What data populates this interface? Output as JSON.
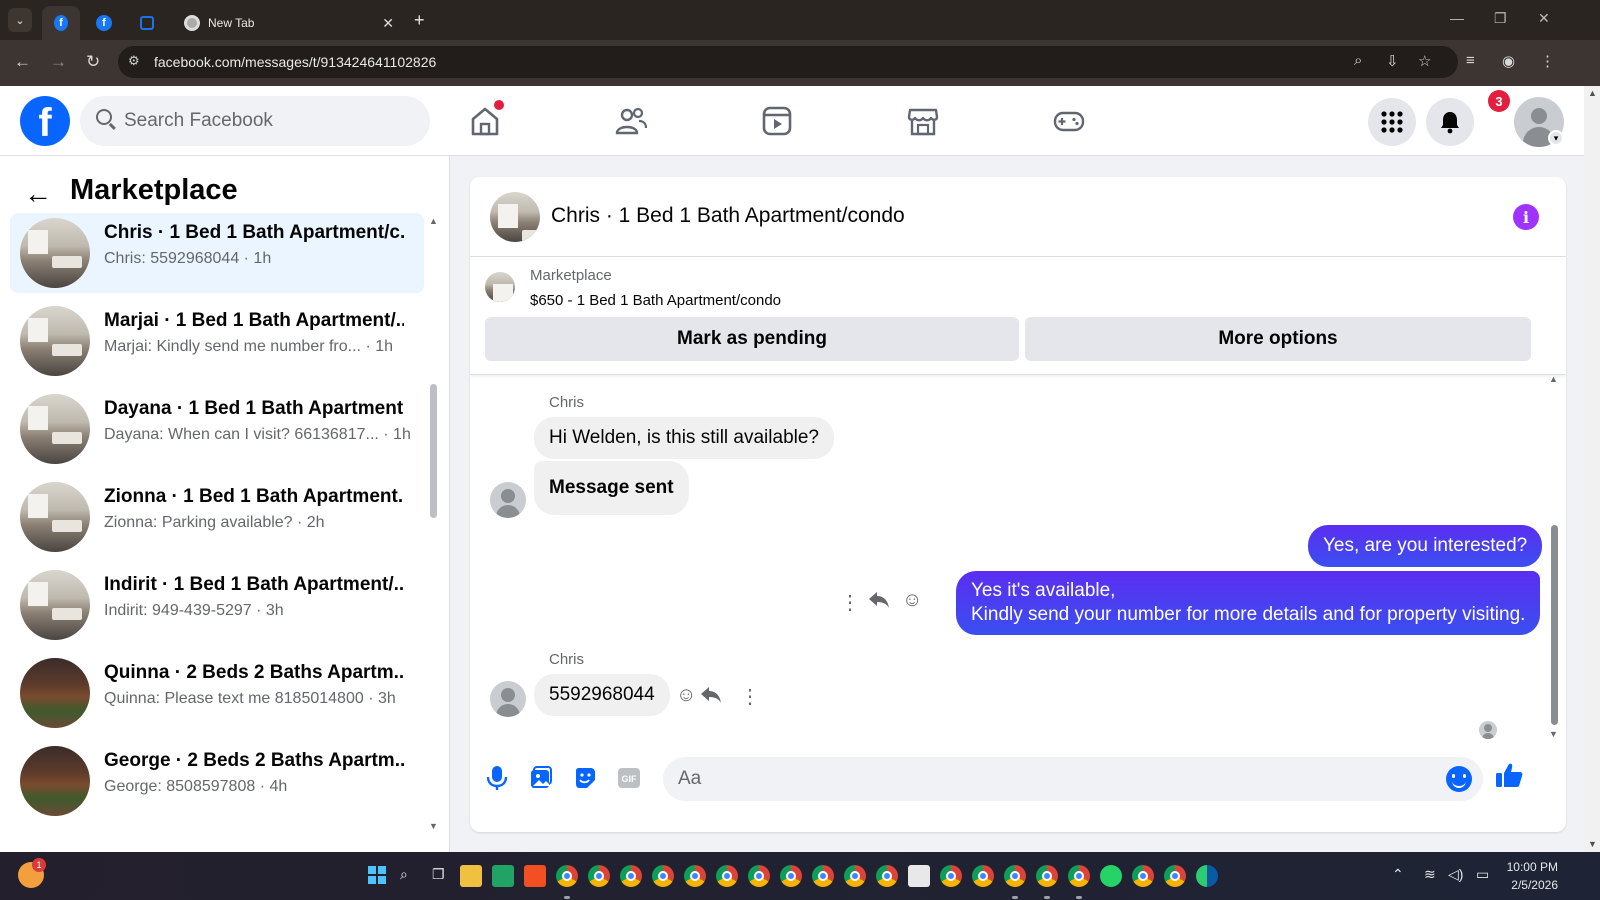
{
  "browser": {
    "tabs": [
      {
        "label": "",
        "favicon": "facebook-icon"
      },
      {
        "label": "",
        "favicon": "facebook-icon"
      },
      {
        "label": "",
        "favicon": "zillow-icon"
      },
      {
        "label": "New Tab",
        "favicon": "chrome-icon"
      }
    ],
    "url": "facebook.com/messages/t/913424641102826"
  },
  "fb": {
    "search_placeholder": "Search Facebook",
    "notifications_count": "3",
    "nav": [
      "home-icon",
      "friends-icon",
      "video-icon",
      "marketplace-icon",
      "gaming-icon"
    ]
  },
  "sidebar": {
    "title": "Marketplace",
    "conversations": [
      {
        "name": "Chris · 1 Bed 1 Bath Apartment/c...",
        "snippet": "Chris: 5592968044 · 1h",
        "thumb": "apartment"
      },
      {
        "name": "Marjai · 1 Bed 1 Bath Apartment/...",
        "snippet": "Marjai: Kindly send me number fro... · 1h",
        "thumb": "apartment"
      },
      {
        "name": "Dayana · 1 Bed 1 Bath Apartment...",
        "snippet": "Dayana: When can I visit? 66136817... · 1h",
        "thumb": "apartment"
      },
      {
        "name": "Zionna · 1 Bed 1 Bath Apartment...",
        "snippet": "Zionna: Parking available? · 2h",
        "thumb": "apartment"
      },
      {
        "name": "Indirit · 1 Bed 1 Bath Apartment/...",
        "snippet": "Indirit: 949-439-5297 · 3h",
        "thumb": "apartment"
      },
      {
        "name": "Quinna · 2 Beds 2 Baths Apartm...",
        "snippet": "Quinna: Please text me 8185014800 · 3h",
        "thumb": "patio"
      },
      {
        "name": "George · 2 Beds 2 Baths Apartm...",
        "snippet": "George: 8508597808 · 4h",
        "thumb": "patio"
      }
    ]
  },
  "chat": {
    "title": "Chris · 1 Bed 1 Bath Apartment/condo",
    "listing_label": "Marketplace",
    "listing_price": "$650 - 1 Bed 1 Bath Apartment/condo",
    "mark_pending": "Mark as pending",
    "more_options": "More options",
    "sender_1": "Chris",
    "msg_1": "Hi Welden, is this still available?",
    "msg_2": "Message sent",
    "out_1": "Yes, are you interested?",
    "out_2_line1": "Yes it's available,",
    "out_2_line2": "Kindly send your number for more details and for property visiting.",
    "sender_2": "Chris",
    "msg_3": "5592968044",
    "composer_placeholder": "Aa"
  },
  "taskbar": {
    "time": "10:00 PM",
    "date": "2/5/2026",
    "weather_badge": "1"
  },
  "colors": {
    "fb_blue": "#0866ff",
    "outgoing_bubble": "#4a3cf0",
    "info_purple": "#a033ff",
    "selected_conv": "#ebf5ff"
  }
}
